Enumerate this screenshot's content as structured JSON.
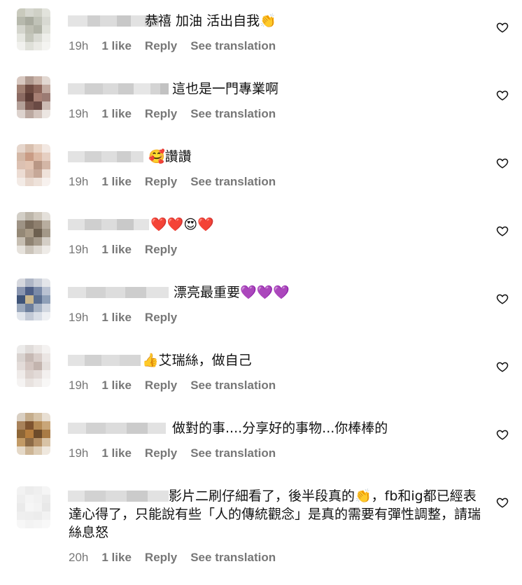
{
  "comments": [
    {
      "text": "恭禧 加油 活出自我👏",
      "time": "19h",
      "likes": "1 like",
      "reply": "Reply",
      "translate": "See translation"
    },
    {
      "text": "這也是一門專業啊",
      "time": "19h",
      "likes": "1 like",
      "reply": "Reply",
      "translate": "See translation"
    },
    {
      "text": "🥰讚讚",
      "time": "19h",
      "likes": "1 like",
      "reply": "Reply",
      "translate": "See translation"
    },
    {
      "text": "❤️❤️😍❤️",
      "time": "19h",
      "likes": "1 like",
      "reply": "Reply",
      "translate": ""
    },
    {
      "text": "漂亮最重要💜💜💜",
      "time": "19h",
      "likes": "1 like",
      "reply": "Reply",
      "translate": ""
    },
    {
      "text": "👍艾瑞絲，做自己",
      "time": "19h",
      "likes": "1 like",
      "reply": "Reply",
      "translate": "See translation"
    },
    {
      "text": "做對的事....分享好的事物...你棒棒的",
      "time": "19h",
      "likes": "1 like",
      "reply": "Reply",
      "translate": "See translation"
    },
    {
      "text": "影片二刷仔細看了，後半段真的👏，fb和ig都已經表達心得了，只能說有些「人的傳統觀念」是真的需要有彈性調整，請瑞絲息怒",
      "time": "20h",
      "likes": "1 like",
      "reply": "Reply",
      "translate": "See translation"
    }
  ],
  "icons": {
    "like": "heart-outline-icon"
  },
  "colors": {
    "meta": "#777777",
    "text": "#111111"
  }
}
